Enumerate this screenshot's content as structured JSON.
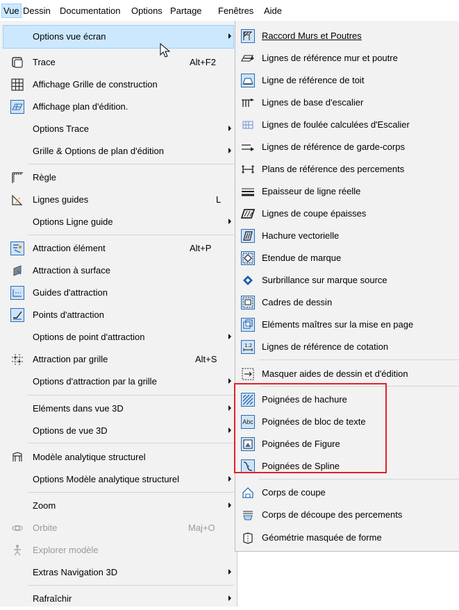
{
  "menubar": {
    "items": [
      "Vue",
      "Dessin",
      "Documentation",
      "Options",
      "Partage",
      "Fenêtres",
      "Aide"
    ]
  },
  "main_menu": {
    "items": [
      {
        "label": "Options vue écran",
        "shortcut": "",
        "submenu": true,
        "icon": "",
        "highlighted": true
      },
      {
        "label": "Trace",
        "shortcut": "Alt+F2",
        "submenu": false,
        "icon": "trace-icon"
      },
      {
        "label": "Affichage Grille de construction",
        "shortcut": "",
        "submenu": false,
        "icon": "grid-icon"
      },
      {
        "label": "Affichage plan d'édition.",
        "shortcut": "",
        "submenu": false,
        "icon": "editing-plane-icon"
      },
      {
        "label": "Options Trace",
        "shortcut": "",
        "submenu": true,
        "icon": ""
      },
      {
        "label": "Grille & Options de plan d'édition",
        "shortcut": "",
        "submenu": true,
        "icon": ""
      },
      {
        "label": "Règle",
        "shortcut": "",
        "submenu": false,
        "icon": "ruler-icon"
      },
      {
        "label": "Lignes guides",
        "shortcut": "L",
        "submenu": false,
        "icon": "guide-lines-icon"
      },
      {
        "label": "Options Ligne guide",
        "shortcut": "",
        "submenu": true,
        "icon": ""
      },
      {
        "label": "Attraction élément",
        "shortcut": "Alt+P",
        "submenu": false,
        "icon": "element-snap-icon"
      },
      {
        "label": "Attraction à surface",
        "shortcut": "",
        "submenu": false,
        "icon": "surface-snap-icon"
      },
      {
        "label": "Guides d'attraction",
        "shortcut": "",
        "submenu": false,
        "icon": "snap-guides-icon"
      },
      {
        "label": "Points d'attraction",
        "shortcut": "",
        "submenu": false,
        "icon": "snap-points-icon"
      },
      {
        "label": "Options de point d'attraction",
        "shortcut": "",
        "submenu": true,
        "icon": ""
      },
      {
        "label": "Attraction par grille",
        "shortcut": "Alt+S",
        "submenu": false,
        "icon": "grid-snap-icon"
      },
      {
        "label": "Options d'attraction par la grille",
        "shortcut": "",
        "submenu": true,
        "icon": ""
      },
      {
        "label": "Eléments dans vue 3D",
        "shortcut": "",
        "submenu": true,
        "icon": ""
      },
      {
        "label": "Options de vue 3D",
        "shortcut": "",
        "submenu": true,
        "icon": ""
      },
      {
        "label": "Modèle analytique structurel",
        "shortcut": "",
        "submenu": false,
        "icon": "structural-model-icon"
      },
      {
        "label": "Options Modèle analytique structurel",
        "shortcut": "",
        "submenu": true,
        "icon": ""
      },
      {
        "label": "Zoom",
        "shortcut": "",
        "submenu": true,
        "icon": ""
      },
      {
        "label": "Orbite",
        "shortcut": "Maj+O",
        "submenu": false,
        "icon": "orbit-icon",
        "disabled": true
      },
      {
        "label": "Explorer modèle",
        "shortcut": "",
        "submenu": false,
        "icon": "explore-model-icon",
        "disabled": true
      },
      {
        "label": "Extras Navigation 3D",
        "shortcut": "",
        "submenu": true,
        "icon": ""
      },
      {
        "label": "Rafraîchir",
        "shortcut": "",
        "submenu": true,
        "icon": ""
      }
    ]
  },
  "sub_menu": {
    "items": [
      {
        "label": "Raccord Murs et Poutres",
        "icon": "wall-beam-junction-icon"
      },
      {
        "label": "Lignes de référence mur et poutre",
        "icon": "wall-reference-line-icon"
      },
      {
        "label": "Ligne de référence de toit",
        "icon": "roof-reference-line-icon"
      },
      {
        "label": "Lignes de base d'escalier",
        "icon": "stair-baseline-icon"
      },
      {
        "label": "Lignes de foulée calculées d'Escalier",
        "icon": "stair-walkline-icon"
      },
      {
        "label": "Lignes de référence de garde-corps",
        "icon": "railing-reference-line-icon"
      },
      {
        "label": "Plans de référence des percements",
        "icon": "opening-reference-plane-icon"
      },
      {
        "label": "Epaisseur de ligne réelle",
        "icon": "true-line-weight-icon"
      },
      {
        "label": "Lignes de coupe épaisses",
        "icon": "bold-cut-lines-icon"
      },
      {
        "label": "Hachure vectorielle",
        "icon": "vectorial-hatching-icon"
      },
      {
        "label": "Etendue de marque",
        "icon": "marker-range-icon"
      },
      {
        "label": "Surbrillance sur marque source",
        "icon": "source-marker-highlight-icon"
      },
      {
        "label": "Cadres de dessin",
        "icon": "drawing-frames-icon"
      },
      {
        "label": "Eléments maîtres sur la mise en page",
        "icon": "master-layout-items-icon"
      },
      {
        "label": "Lignes de référence de cotation",
        "icon": "dimension-reference-lines-icon"
      },
      {
        "label": "Masquer aides de dessin et d'édition",
        "icon": "hide-drafting-aids-icon"
      },
      {
        "label": "Poignées de hachure",
        "icon": "fill-handles-icon"
      },
      {
        "label": "Poignées de bloc de texte",
        "icon": "text-block-handles-icon"
      },
      {
        "label": "Poignées de Figure",
        "icon": "figure-handles-icon"
      },
      {
        "label": "Poignées de Spline",
        "icon": "spline-handles-icon"
      },
      {
        "label": "Corps de coupe",
        "icon": "section-body-icon"
      },
      {
        "label": "Corps de découpe des percements",
        "icon": "opening-cut-body-icon"
      },
      {
        "label": "Géométrie masquée de forme",
        "icon": "hidden-morph-geometry-icon"
      }
    ]
  },
  "colors": {
    "highlight": "#cce8ff",
    "highlight_border": "#99d1ff",
    "annotation_box": "#e0202a",
    "icon_accent": "#2e6bb0"
  }
}
